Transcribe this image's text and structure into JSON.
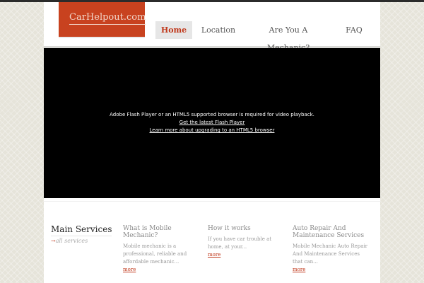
{
  "site": {
    "logo": "CarHelpout.com"
  },
  "nav": {
    "items": [
      {
        "label": "Home",
        "active": true
      },
      {
        "label": "Location",
        "active": false
      },
      {
        "label": "Are You A Mechanic?",
        "active": false
      },
      {
        "label": "FAQ",
        "active": false
      }
    ]
  },
  "video": {
    "message": "Adobe Flash Player or an HTML5 supported browser is required for video playback.",
    "link_flash": "Get the latest Flash Player",
    "link_html5": "Learn more about upgrading to an HTML5 browser"
  },
  "services": {
    "title": "Main Services",
    "all_link": "all services",
    "items": [
      {
        "title": "What is Mobile Mechanic?",
        "text": "Mobile mechanic is a professional, reliable and affordable mechanic...",
        "more": "more"
      },
      {
        "title": "How it works",
        "text": "If you have car trouble at home, at your...",
        "more": "more"
      },
      {
        "title": "Auto Repair And Maintenance Services",
        "text": "Mobile Mechanic Auto Repair And Maintenance Services that can...",
        "more": "more"
      }
    ]
  },
  "colors": {
    "accent": "#c8421f",
    "background": "#e6e4da",
    "nav_active_bg": "#e6e6e6",
    "video_bg": "#000000"
  }
}
